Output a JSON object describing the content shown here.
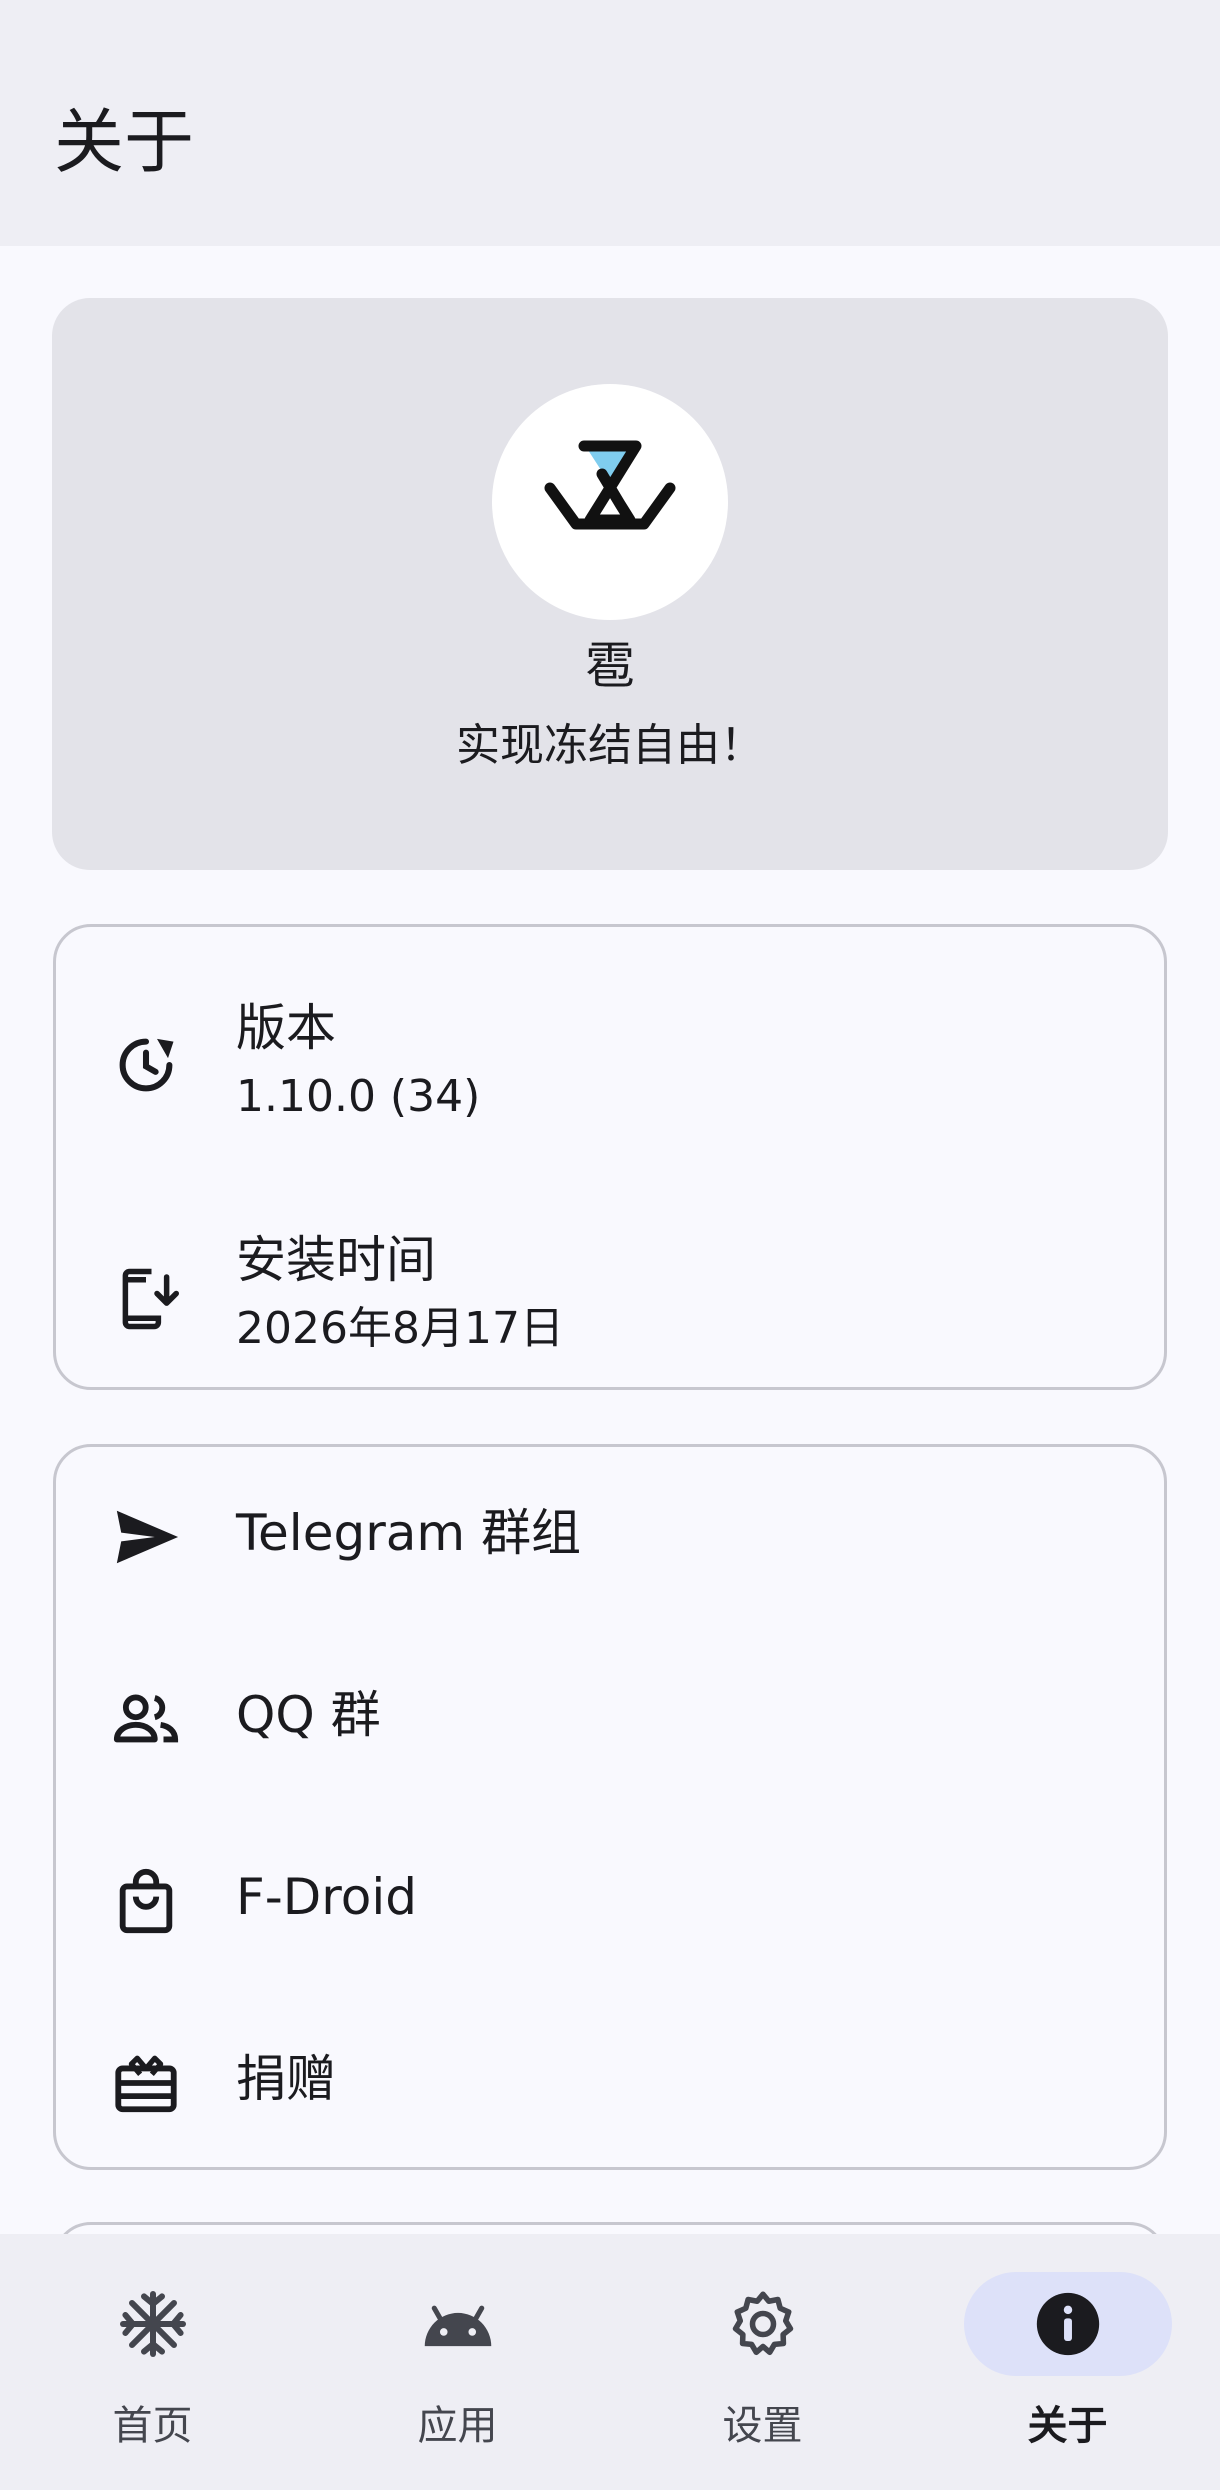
{
  "header": {
    "title": "关于"
  },
  "app": {
    "name": "雹",
    "slogan": "实现冻结自由！",
    "logo_accent": "#7fcdef"
  },
  "info": [
    {
      "label": "版本",
      "value": "1.10.0 (34)",
      "icon": "update-icon"
    },
    {
      "label": "安装时间",
      "value": "2026年8月17日",
      "icon": "install-mobile-icon"
    }
  ],
  "links": [
    {
      "label": "Telegram 群组",
      "icon": "send-icon"
    },
    {
      "label": "QQ 群",
      "icon": "group-icon"
    },
    {
      "label": "F-Droid",
      "icon": "shopping-bag-icon"
    },
    {
      "label": "捐赠",
      "icon": "gift-card-icon"
    }
  ],
  "nav": {
    "items": [
      {
        "label": "首页",
        "icon": "snowflake-icon"
      },
      {
        "label": "应用",
        "icon": "android-icon"
      },
      {
        "label": "设置",
        "icon": "settings-icon"
      },
      {
        "label": "关于",
        "icon": "info-icon",
        "active": true
      }
    ],
    "active_color": "#dde1f9"
  }
}
